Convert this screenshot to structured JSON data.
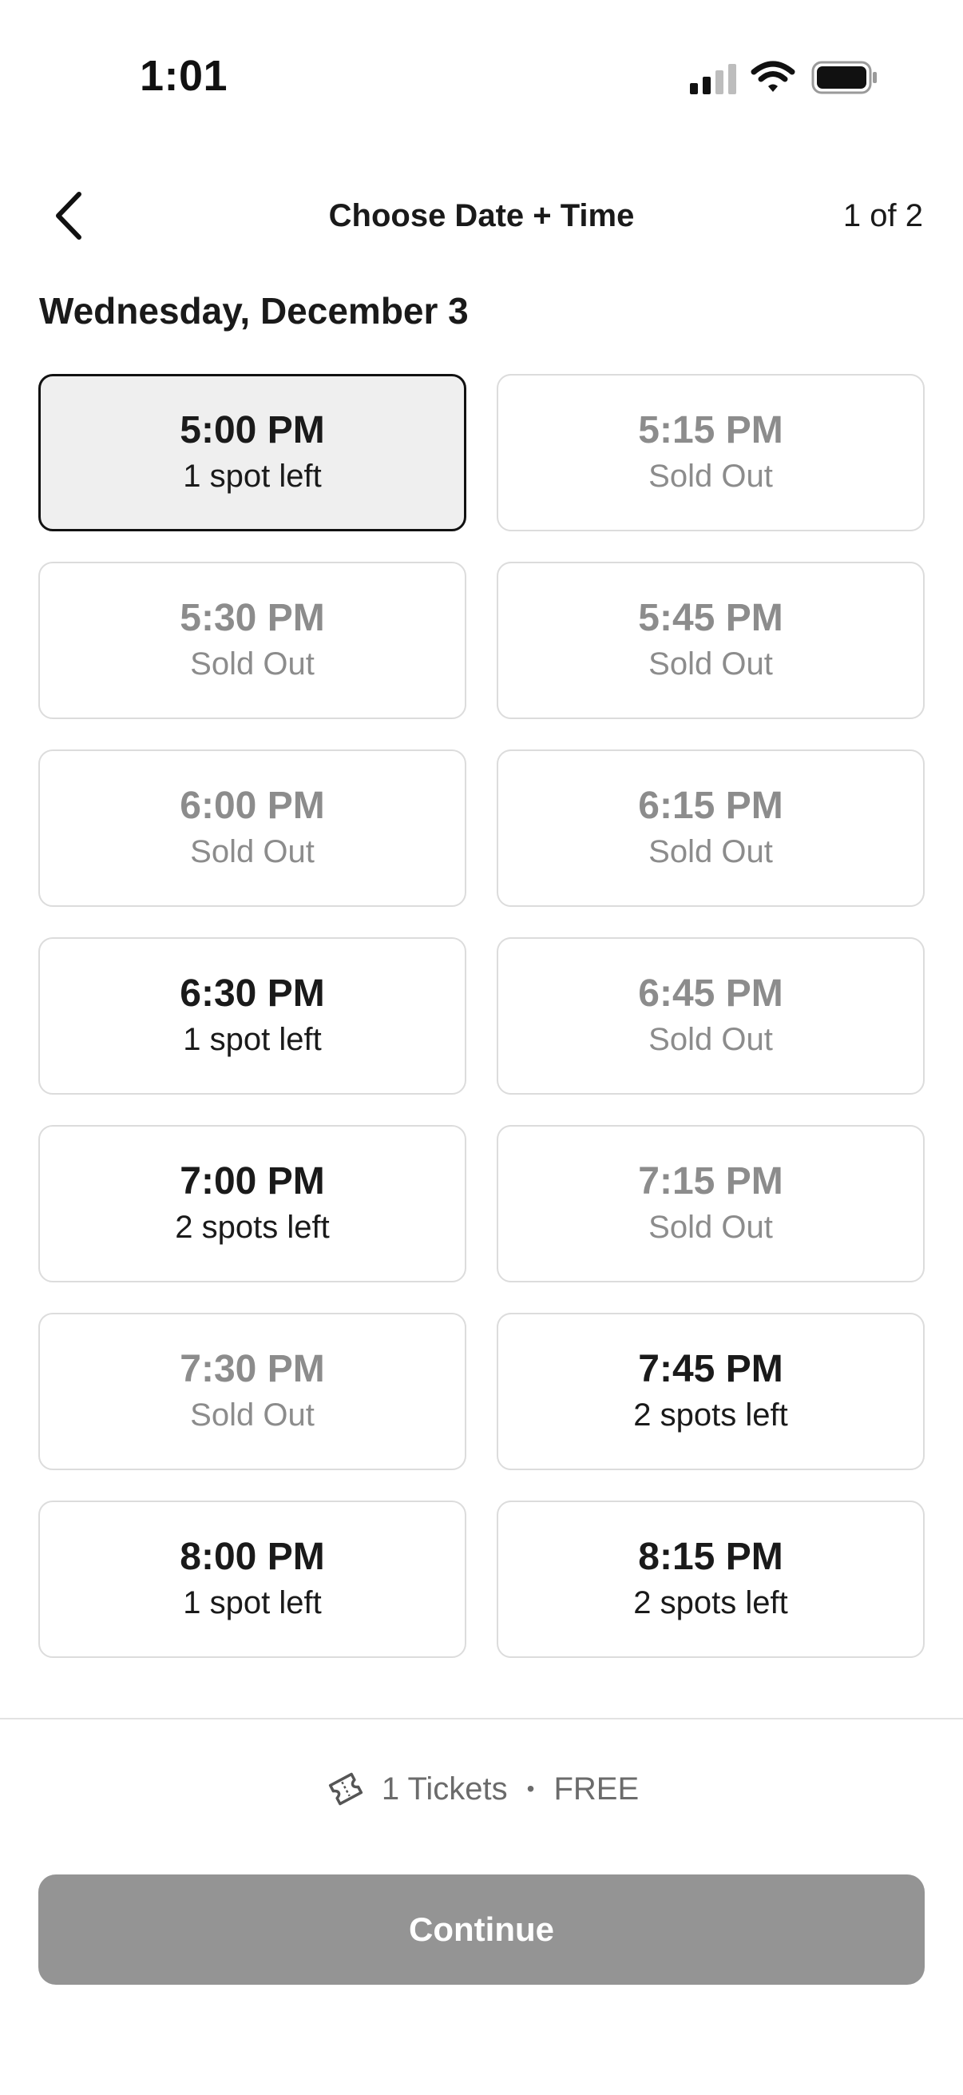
{
  "status_bar": {
    "time": "1:01",
    "icons": [
      "signal-icon",
      "wifi-icon",
      "battery-icon"
    ]
  },
  "header": {
    "back_icon": "chevron-left-icon",
    "title": "Choose Date + Time",
    "step": "1 of 2"
  },
  "date_heading": "Wednesday, December 3",
  "slots": [
    {
      "time": "5:00 PM",
      "status": "1 spot left",
      "available": true,
      "selected": true
    },
    {
      "time": "5:15 PM",
      "status": "Sold Out",
      "available": false,
      "selected": false
    },
    {
      "time": "5:30 PM",
      "status": "Sold Out",
      "available": false,
      "selected": false
    },
    {
      "time": "5:45 PM",
      "status": "Sold Out",
      "available": false,
      "selected": false
    },
    {
      "time": "6:00 PM",
      "status": "Sold Out",
      "available": false,
      "selected": false
    },
    {
      "time": "6:15 PM",
      "status": "Sold Out",
      "available": false,
      "selected": false
    },
    {
      "time": "6:30 PM",
      "status": "1 spot left",
      "available": true,
      "selected": false
    },
    {
      "time": "6:45 PM",
      "status": "Sold Out",
      "available": false,
      "selected": false
    },
    {
      "time": "7:00 PM",
      "status": "2 spots left",
      "available": true,
      "selected": false
    },
    {
      "time": "7:15 PM",
      "status": "Sold Out",
      "available": false,
      "selected": false
    },
    {
      "time": "7:30 PM",
      "status": "Sold Out",
      "available": false,
      "selected": false
    },
    {
      "time": "7:45 PM",
      "status": "2 spots left",
      "available": true,
      "selected": false
    },
    {
      "time": "8:00 PM",
      "status": "1 spot left",
      "available": true,
      "selected": false
    },
    {
      "time": "8:15 PM",
      "status": "2 spots left",
      "available": true,
      "selected": false
    }
  ],
  "footer": {
    "ticket_icon": "ticket-icon",
    "tickets_label": "1 Tickets",
    "separator": "•",
    "price_label": "FREE",
    "continue_label": "Continue"
  },
  "colors": {
    "text_primary": "#1a1a1a",
    "text_muted": "#8c8c8c",
    "slot_border": "#dcdcdc",
    "selected_bg": "#efefef",
    "selected_border": "#111111",
    "button_disabled_bg": "#949494"
  }
}
